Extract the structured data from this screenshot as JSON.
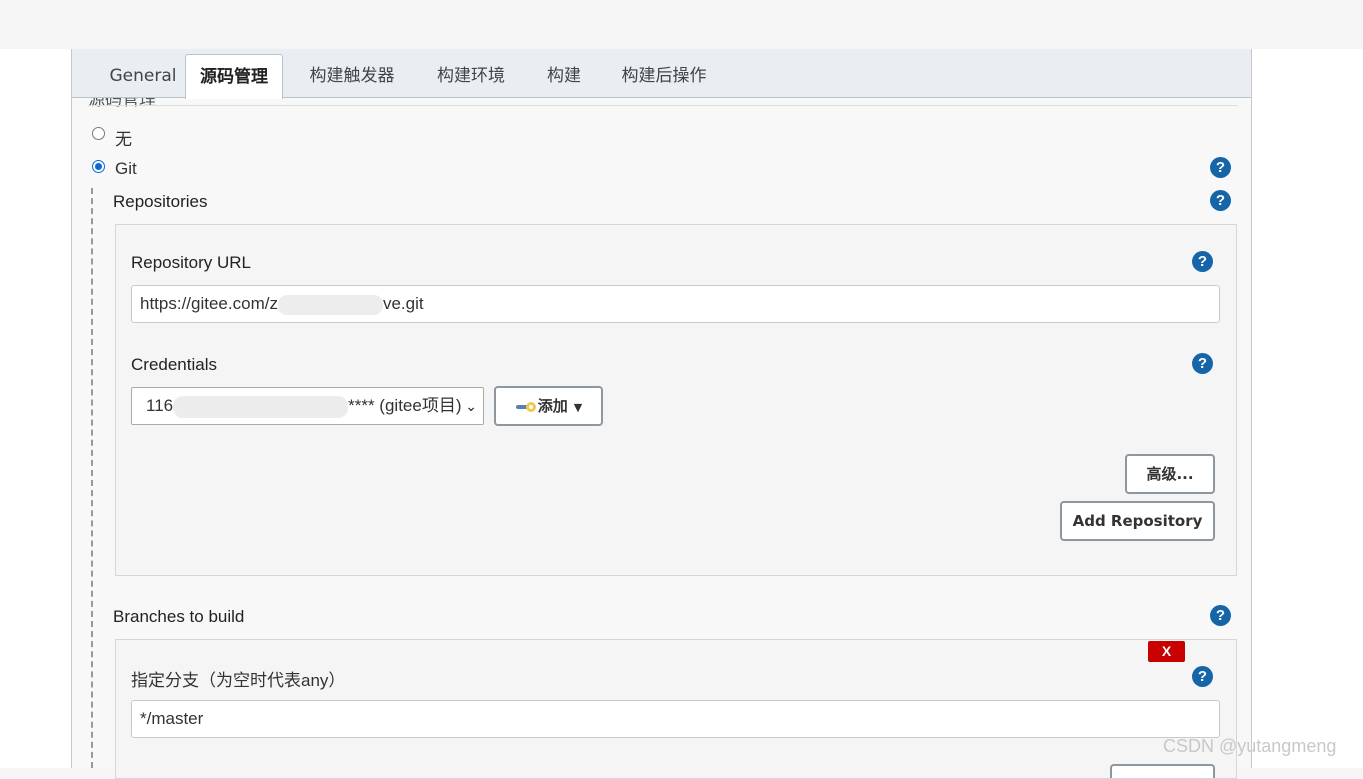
{
  "tabs": [
    {
      "label": "General",
      "active": false
    },
    {
      "label": "源码管理",
      "active": true
    },
    {
      "label": "构建触发器",
      "active": false
    },
    {
      "label": "构建环境",
      "active": false
    },
    {
      "label": "构建",
      "active": false
    },
    {
      "label": "构建后操作",
      "active": false
    }
  ],
  "scm": {
    "section_title": "源码管理",
    "option_none": "无",
    "option_git": "Git",
    "selected": "Git"
  },
  "repositories": {
    "title": "Repositories",
    "url_label": "Repository URL",
    "url_value_start": "https://gitee.com/z",
    "url_value_end": "ve.git",
    "credentials_label": "Credentials",
    "credentials_value_start": "116",
    "credentials_value_end": "**** (gitee项目)",
    "add_label": "添加",
    "advanced_label": "高级...",
    "add_repo_label": "Add Repository"
  },
  "branches": {
    "title": "Branches to build",
    "specifier_label": "指定分支（为空时代表any）",
    "specifier_value": "*/master",
    "delete_label": "X"
  },
  "help_glyph": "?",
  "watermark": "CSDN @yutangmeng",
  "colors": {
    "help": "#1565a8",
    "delete": "#c80000",
    "radio_checked": "#0b69d8"
  }
}
